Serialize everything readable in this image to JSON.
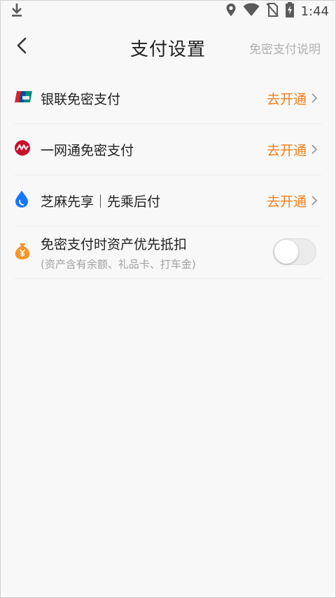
{
  "status_bar": {
    "time": "1:44",
    "icons": [
      "download-icon",
      "location-icon",
      "wifi-icon",
      "no-sim-icon",
      "battery-charging-icon"
    ]
  },
  "header": {
    "title": "支付设置",
    "right_link": "免密支付说明",
    "back_icon": "back-chevron-icon"
  },
  "rows": [
    {
      "label": "银联免密支付",
      "action": "去开通",
      "icon": "unionpay-icon"
    },
    {
      "label": "一网通免密支付",
      "action": "去开通",
      "icon": "yiwangtong-icon"
    },
    {
      "label": "芝麻先享｜先乘后付",
      "action": "去开通",
      "icon": "zhima-icon"
    }
  ],
  "asset_row": {
    "label": "免密支付时资产优先抵扣",
    "sub": "(资产含有余额、礼品卡、打车金)",
    "icon": "money-bag-icon",
    "toggle_on": false
  },
  "colors": {
    "accent_orange": "#f57f17",
    "link_gray": "#b0b0b0",
    "zhima_blue": "#1677ff",
    "yiwangtong_red": "#c8102e",
    "money_bag_orange": "#f7942a"
  }
}
